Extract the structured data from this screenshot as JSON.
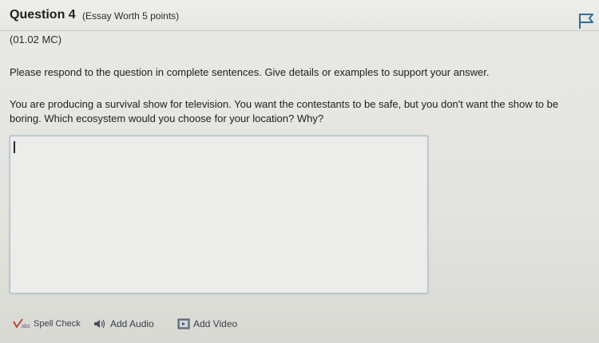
{
  "question": {
    "title": "Question 4",
    "worth": "(Essay Worth 5 points)",
    "code": "(01.02 MC)"
  },
  "instructions": "Please respond to the question in complete sentences. Give details or examples to support your answer.",
  "prompt": "You are producing a survival show for television. You want the contestants to be safe, but you don't want the show to be boring. Which ecosystem would you choose for your location? Why?",
  "answer": {
    "value": ""
  },
  "toolbar": {
    "spell_check": "Spell Check",
    "add_audio": "Add Audio",
    "add_video": "Add Video"
  },
  "icons": {
    "flag": "flag-icon",
    "spell_check": "spell-check-icon",
    "audio": "speaker-icon",
    "video": "film-icon"
  },
  "colors": {
    "answer_border": "#a9bfc6",
    "flag": "#2f6f9a",
    "spell_check_mark": "#c0392b"
  }
}
